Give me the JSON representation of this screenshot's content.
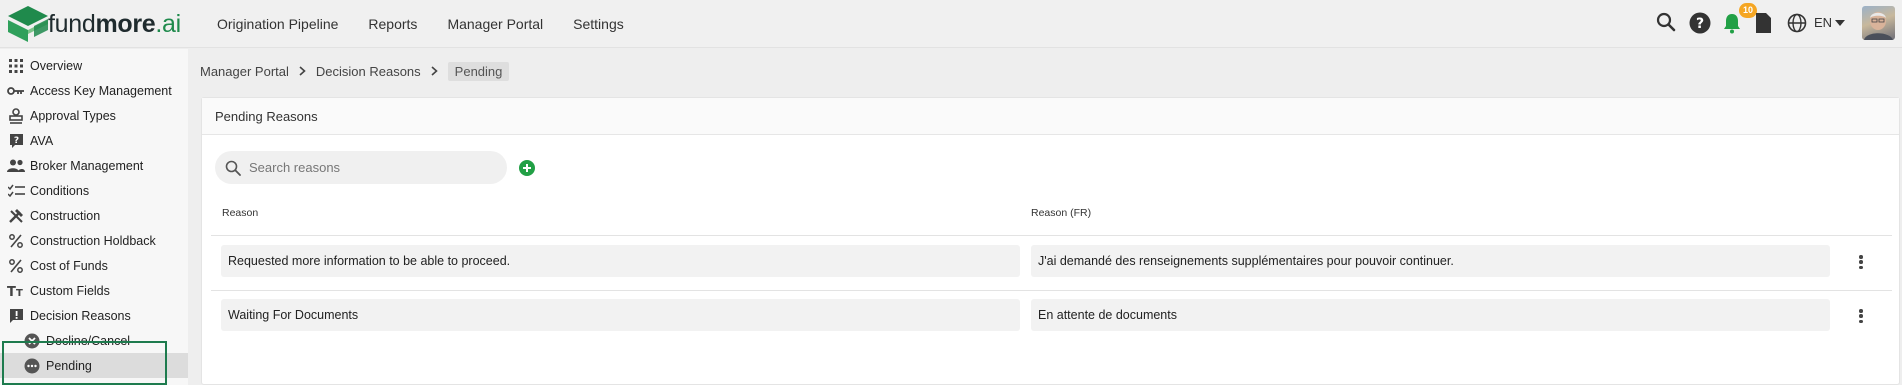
{
  "brand": {
    "name_regular": "fund",
    "name_bold": "more",
    "name_suffix": ".ai",
    "accent": "#1f8a4c"
  },
  "nav": {
    "items": [
      {
        "label": "Origination Pipeline"
      },
      {
        "label": "Reports"
      },
      {
        "label": "Manager Portal"
      },
      {
        "label": "Settings"
      }
    ]
  },
  "topbar": {
    "notifications_count": "10",
    "language": "EN",
    "icons": [
      "search-icon",
      "help-icon",
      "bell-icon",
      "document-icon",
      "globe-icon",
      "caret-down-icon"
    ]
  },
  "sidebar": {
    "items": [
      {
        "label": "Overview",
        "icon": "grid-icon"
      },
      {
        "label": "Access Key Management",
        "icon": "key-icon"
      },
      {
        "label": "Approval Types",
        "icon": "stamp-icon"
      },
      {
        "label": "AVA",
        "icon": "question-box-icon"
      },
      {
        "label": "Broker Management",
        "icon": "people-icon"
      },
      {
        "label": "Conditions",
        "icon": "checklist-icon"
      },
      {
        "label": "Construction",
        "icon": "tools-icon"
      },
      {
        "label": "Construction Holdback",
        "icon": "percent-icon"
      },
      {
        "label": "Cost of Funds",
        "icon": "percent-icon"
      },
      {
        "label": "Custom Fields",
        "icon": "text-format-icon"
      },
      {
        "label": "Decision Reasons",
        "icon": "feedback-icon"
      },
      {
        "label": "Decline/Cancel",
        "icon": "close-circle-icon"
      },
      {
        "label": "Pending",
        "icon": "more-circle-icon"
      }
    ],
    "active": "Pending"
  },
  "breadcrumb": {
    "items": [
      "Manager Portal",
      "Decision Reasons"
    ],
    "current": "Pending"
  },
  "card": {
    "title": "Pending Reasons",
    "search_placeholder": "Search reasons",
    "columns": [
      "Reason",
      "Reason (FR)"
    ],
    "rows": [
      {
        "reason": "Requested more information to be able to proceed.",
        "reason_fr": "J'ai demandé des renseignements supplémentaires pour pouvoir continuer."
      },
      {
        "reason": "Waiting For Documents",
        "reason_fr": "En attente de documents"
      }
    ]
  }
}
